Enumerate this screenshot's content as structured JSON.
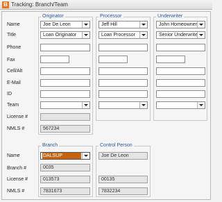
{
  "window": {
    "icon_letter": "B",
    "title": "Tracking: Branch/Team"
  },
  "row_labels": {
    "name": "Name",
    "title": "Title",
    "phone": "Phone",
    "fax": "Fax",
    "cell": "Cell/Alt",
    "email": "E-Mail",
    "id": "ID",
    "team": "Team",
    "license": "License #",
    "nmls": "NMLS #"
  },
  "originator": {
    "legend": "Originator",
    "name": "Joe De Leon",
    "title": "Loan Originator",
    "license": "",
    "nmls": "567234"
  },
  "processor": {
    "legend": "Processor",
    "name": "Jeff Hill",
    "title": "Loan Processor"
  },
  "underwriter": {
    "legend": "Underwriter",
    "name": "John Homeowner",
    "title": "Senior Underwriter"
  },
  "branch_section": {
    "labels": {
      "name": "Name",
      "branch_num": "Branch #",
      "license": "License #",
      "nmls": "NMLS #"
    },
    "branch": {
      "legend": "Branch",
      "name": "DALSUP",
      "branch_num": "0035",
      "license": "013573",
      "nmls": "7831673"
    },
    "control_person": {
      "legend": "Control Person",
      "name": "Joe De Leon",
      "license": "00135",
      "nmls": "7832234"
    }
  },
  "colors": {
    "accent": "#e8731c",
    "legend_text": "#2b55a3",
    "highlight": "#c4640f"
  }
}
